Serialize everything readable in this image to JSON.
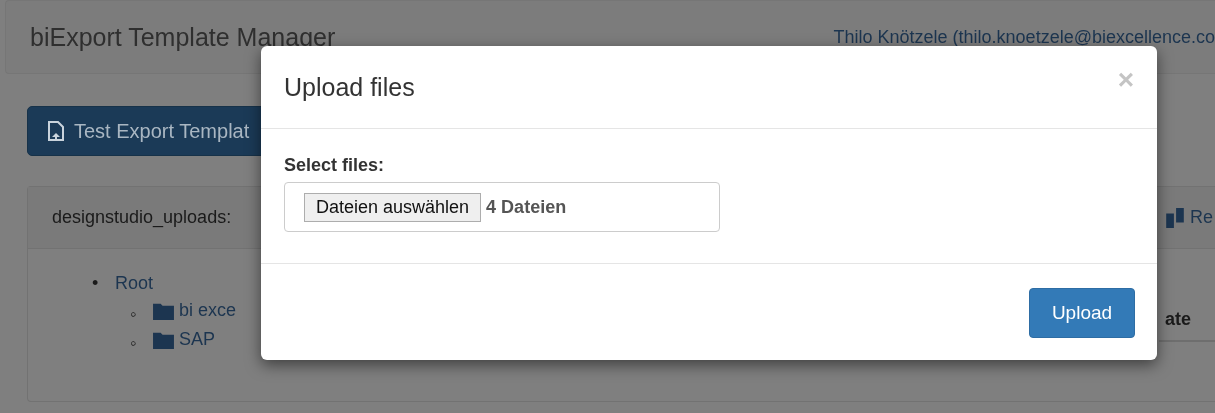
{
  "navbar": {
    "brand": "biExport Template Manager",
    "user": "Thilo Knötzele (thilo.knoetzele@biexcellence.co"
  },
  "test_button": {
    "label": "Test Export Templat"
  },
  "panel": {
    "title": "designstudio_uploads:",
    "action": "Re",
    "column_header": "ate",
    "tree": [
      {
        "marker": "•",
        "label": "Root",
        "children": [
          {
            "marker": "◦",
            "label": "bi exce"
          },
          {
            "marker": "◦",
            "label": "SAP"
          }
        ]
      }
    ]
  },
  "modal": {
    "title": "Upload files",
    "close": "×",
    "field_label": "Select files:",
    "choose_button": "Dateien auswählen",
    "file_status": "4 Dateien",
    "submit": "Upload"
  }
}
